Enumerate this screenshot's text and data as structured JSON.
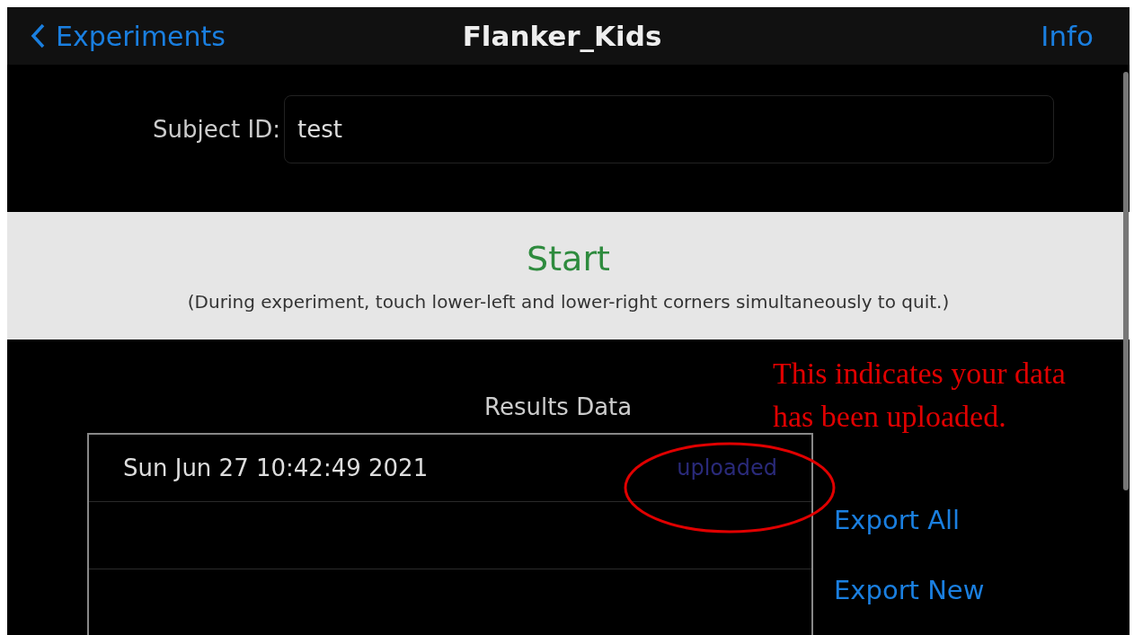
{
  "nav_bar": {
    "back": "Experiments",
    "title": "Flanker_Kids",
    "action": "Info"
  },
  "subject": {
    "label": "Subject ID:",
    "value": "test"
  },
  "start": {
    "label": "Start",
    "note": "(During experiment, touch lower-left and lower-right corners simultaneously to quit.)"
  },
  "results": {
    "title": "Results Data",
    "rows": [
      {
        "date": "Sun Jun 27 10:42:49 2021",
        "status": "uploaded"
      }
    ],
    "buttons": [
      "Export All",
      "Export New"
    ]
  },
  "annotation": {
    "text": "This indicates your data has been uploaded."
  }
}
